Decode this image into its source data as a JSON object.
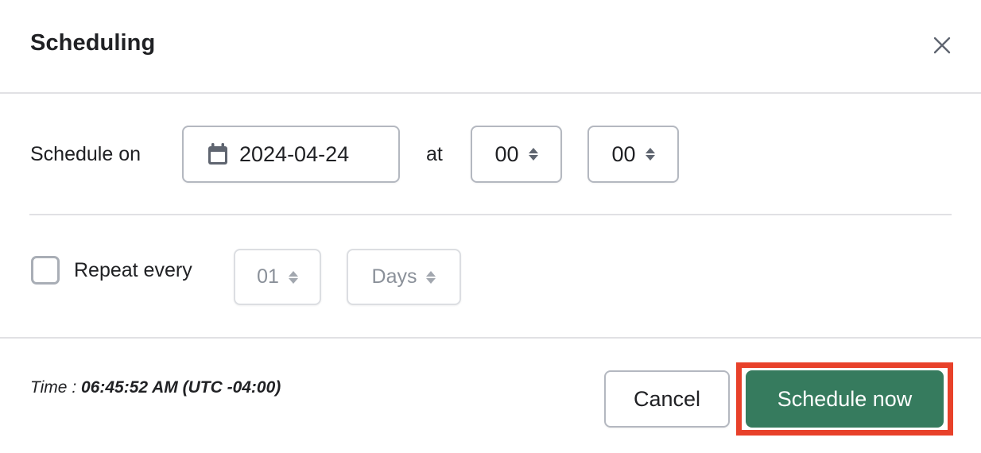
{
  "dialog": {
    "title": "Scheduling",
    "close_icon": "close-icon"
  },
  "schedule": {
    "label": "Schedule on",
    "date_icon": "calendar-icon",
    "date_value": "2024-04-24",
    "at_label": "at",
    "hour_value": "00",
    "minute_value": "00"
  },
  "repeat": {
    "checked": false,
    "label": "Repeat every",
    "interval_value": "01",
    "unit_value": "Days",
    "disabled": true
  },
  "footer": {
    "time_label": "Time : ",
    "time_value": "06:45:52 AM (UTC -04:00)",
    "cancel_label": "Cancel",
    "primary_label": "Schedule now"
  },
  "colors": {
    "primary": "#367b5e",
    "highlight": "#e8412a",
    "divider": "#e1e1e4"
  }
}
